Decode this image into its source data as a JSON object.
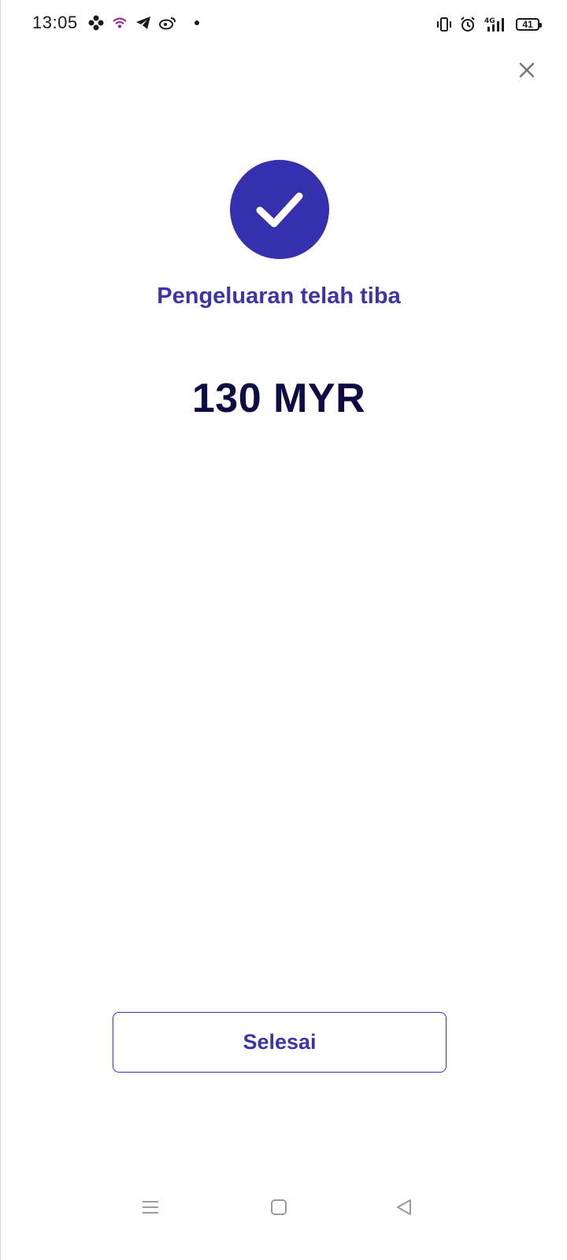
{
  "status_bar": {
    "time": "13:05",
    "battery_level": "41",
    "left_icons": [
      "game-icon",
      "wifi-calling-icon",
      "telegram-icon",
      "weibo-icon",
      "notification-dot"
    ],
    "right_icons": [
      "vibrate-icon",
      "alarm-icon",
      "signal-4g-icon",
      "battery-icon"
    ]
  },
  "screen": {
    "headline": "Pengeluaran telah tiba",
    "amount": "130 MYR",
    "done_label": "Selesai"
  },
  "colors": {
    "accent": "#3530ad",
    "amount_text": "#0e0c45",
    "close_icon": "#777777"
  },
  "nav_bar": {
    "buttons": [
      "menu-icon",
      "home-icon",
      "back-icon"
    ]
  }
}
